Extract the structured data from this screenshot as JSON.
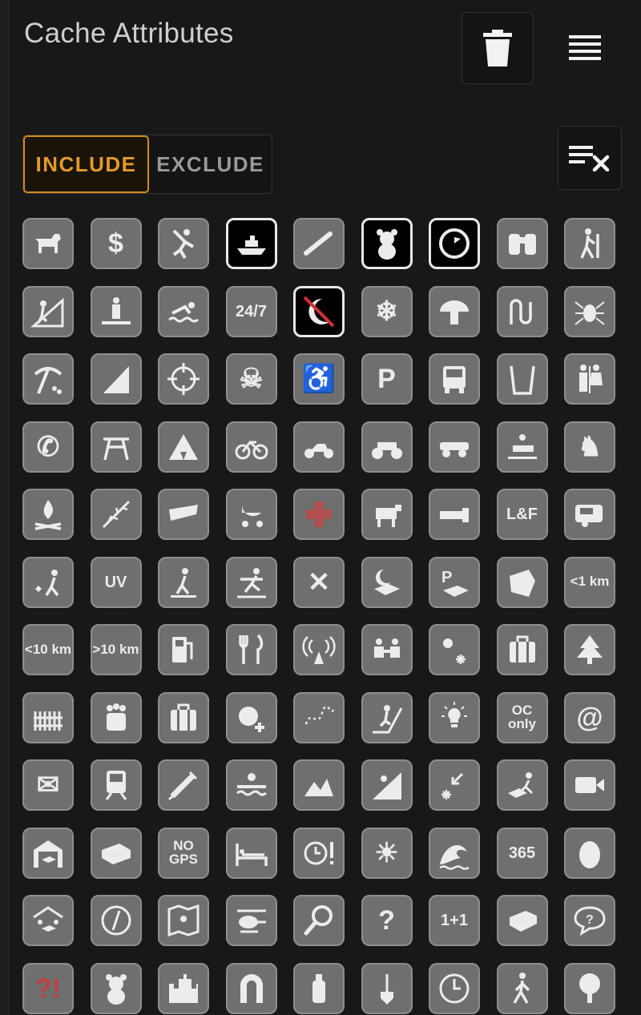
{
  "header": {
    "title": "Cache Attributes"
  },
  "mode": {
    "include_label": "INCLUDE",
    "exclude_label": "EXCLUDE",
    "selected": "include"
  },
  "attributes": [
    {
      "icon": "dog-icon",
      "state": "none"
    },
    {
      "icon": "dollar-icon",
      "state": "none",
      "text": "$"
    },
    {
      "icon": "climbing-icon",
      "state": "none"
    },
    {
      "icon": "boat-icon",
      "state": "include"
    },
    {
      "icon": "scuba-icon",
      "state": "none"
    },
    {
      "icon": "teddy-bear-icon",
      "state": "include"
    },
    {
      "icon": "timer-icon",
      "state": "include"
    },
    {
      "icon": "binoculars-icon",
      "state": "none"
    },
    {
      "icon": "hiking-icon",
      "state": "none"
    },
    {
      "icon": "climb-hill-icon",
      "state": "none"
    },
    {
      "icon": "wading-icon",
      "state": "none"
    },
    {
      "icon": "swimming-icon",
      "state": "none"
    },
    {
      "icon": "available-24-7-icon",
      "state": "none",
      "text": "24/7"
    },
    {
      "icon": "night-cache-icon",
      "state": "exclude"
    },
    {
      "icon": "snowflake-icon",
      "state": "none",
      "text": "❄"
    },
    {
      "icon": "mushroom-icon",
      "state": "none"
    },
    {
      "icon": "snake-icon",
      "state": "none"
    },
    {
      "icon": "tick-icon",
      "state": "none"
    },
    {
      "icon": "mine-icon",
      "state": "none"
    },
    {
      "icon": "cliff-icon",
      "state": "none"
    },
    {
      "icon": "crosshair-icon",
      "state": "none"
    },
    {
      "icon": "skull-icon",
      "state": "none",
      "text": "☠"
    },
    {
      "icon": "wheelchair-icon",
      "state": "none",
      "text": "♿"
    },
    {
      "icon": "parking-icon",
      "state": "none",
      "text": "P"
    },
    {
      "icon": "bus-icon",
      "state": "none"
    },
    {
      "icon": "water-glass-icon",
      "state": "none"
    },
    {
      "icon": "restroom-icon",
      "state": "none"
    },
    {
      "icon": "phone-icon",
      "state": "none",
      "text": "✆"
    },
    {
      "icon": "picnic-table-icon",
      "state": "none"
    },
    {
      "icon": "tent-icon",
      "state": "none"
    },
    {
      "icon": "bicycle-icon",
      "state": "none"
    },
    {
      "icon": "motorcycle-icon",
      "state": "none"
    },
    {
      "icon": "quad-icon",
      "state": "none"
    },
    {
      "icon": "jeep-icon",
      "state": "none"
    },
    {
      "icon": "snowmobile-icon",
      "state": "none"
    },
    {
      "icon": "horse-icon",
      "state": "none",
      "text": "♞"
    },
    {
      "icon": "campfire-icon",
      "state": "none"
    },
    {
      "icon": "thorn-icon",
      "state": "none"
    },
    {
      "icon": "stealth-icon",
      "state": "none"
    },
    {
      "icon": "stroller-icon",
      "state": "none"
    },
    {
      "icon": "first-aid-icon",
      "state": "none"
    },
    {
      "icon": "cow-icon",
      "state": "none"
    },
    {
      "icon": "flashlight-icon",
      "state": "none"
    },
    {
      "icon": "lost-and-found-icon",
      "state": "none",
      "text": "L&F"
    },
    {
      "icon": "rv-icon",
      "state": "none"
    },
    {
      "icon": "field-puzzle-icon",
      "state": "none"
    },
    {
      "icon": "uv-light-icon",
      "state": "none",
      "text": "UV"
    },
    {
      "icon": "snowshoes-icon",
      "state": "none"
    },
    {
      "icon": "cross-country-ski-icon",
      "state": "none"
    },
    {
      "icon": "special-tool-icon",
      "state": "none",
      "text": "✕"
    },
    {
      "icon": "night-cache-box-icon",
      "state": "none"
    },
    {
      "icon": "park-and-grab-icon",
      "state": "none"
    },
    {
      "icon": "abandoned-structure-icon",
      "state": "none"
    },
    {
      "icon": "short-hike-icon",
      "state": "none",
      "text": "<1 km"
    },
    {
      "icon": "medium-hike-icon",
      "state": "none",
      "text": "<10 km"
    },
    {
      "icon": "long-hike-icon",
      "state": "none",
      "text": ">10 km"
    },
    {
      "icon": "fuel-icon",
      "state": "none"
    },
    {
      "icon": "food-icon",
      "state": "none"
    },
    {
      "icon": "wireless-beacon-icon",
      "state": "none"
    },
    {
      "icon": "partnership-icon",
      "state": "none"
    },
    {
      "icon": "seasonal-icon",
      "state": "none"
    },
    {
      "icon": "tourist-ok-icon",
      "state": "none"
    },
    {
      "icon": "tree-climbing-icon",
      "state": "none"
    },
    {
      "icon": "front-yard-icon",
      "state": "none"
    },
    {
      "icon": "teamwork-icon",
      "state": "none"
    },
    {
      "icon": "geotour-icon",
      "state": "none"
    },
    {
      "icon": "bonus-cache-icon",
      "state": "none"
    },
    {
      "icon": "power-trail-icon",
      "state": "none"
    },
    {
      "icon": "challenge-cache-icon",
      "state": "none"
    },
    {
      "icon": "solution-checker-icon",
      "state": "none"
    },
    {
      "icon": "oc-only-icon",
      "state": "none",
      "text": "OC only"
    },
    {
      "icon": "email-at-icon",
      "state": "none",
      "text": "@"
    },
    {
      "icon": "letterbox-icon",
      "state": "none",
      "text": "✉"
    },
    {
      "icon": "train-icon",
      "state": "none"
    },
    {
      "icon": "syringe-icon",
      "state": "none"
    },
    {
      "icon": "in-water-icon",
      "state": "none"
    },
    {
      "icon": "hills-icon",
      "state": "none"
    },
    {
      "icon": "steep-climb-icon",
      "state": "none"
    },
    {
      "icon": "compass-direction-icon",
      "state": "none"
    },
    {
      "icon": "hidden-box-icon",
      "state": "none"
    },
    {
      "icon": "webcam-icon",
      "state": "none"
    },
    {
      "icon": "shelter-icon",
      "state": "none"
    },
    {
      "icon": "box-icon",
      "state": "none"
    },
    {
      "icon": "no-gps-icon",
      "state": "none",
      "text": "NO GPS"
    },
    {
      "icon": "overnight-icon",
      "state": "none"
    },
    {
      "icon": "time-specific-icon",
      "state": "none"
    },
    {
      "icon": "daytime-icon",
      "state": "none",
      "text": "☀"
    },
    {
      "icon": "tide-icon",
      "state": "none"
    },
    {
      "icon": "all-year-icon",
      "state": "none",
      "text": "365"
    },
    {
      "icon": "egg-icon",
      "state": "none"
    },
    {
      "icon": "shelter-box-icon",
      "state": "none"
    },
    {
      "icon": "compass-icon",
      "state": "none"
    },
    {
      "icon": "map-icon",
      "state": "none"
    },
    {
      "icon": "helicopter-icon",
      "state": "none"
    },
    {
      "icon": "magnifier-icon",
      "state": "none"
    },
    {
      "icon": "puzzle-icon",
      "state": "none",
      "text": "?"
    },
    {
      "icon": "math-icon",
      "state": "none",
      "text": "1+1"
    },
    {
      "icon": "container-icon",
      "state": "none"
    },
    {
      "icon": "question-bubble-icon",
      "state": "none"
    },
    {
      "icon": "surprise-icon",
      "state": "none",
      "text": "?!"
    },
    {
      "icon": "teddy-icon",
      "state": "none"
    },
    {
      "icon": "castle-icon",
      "state": "none"
    },
    {
      "icon": "magnet-icon",
      "state": "none"
    },
    {
      "icon": "bottle-icon",
      "state": "none"
    },
    {
      "icon": "shovel-icon",
      "state": "none"
    },
    {
      "icon": "clock-icon",
      "state": "none"
    },
    {
      "icon": "walking-icon",
      "state": "none"
    },
    {
      "icon": "tree-icon",
      "state": "none"
    }
  ]
}
